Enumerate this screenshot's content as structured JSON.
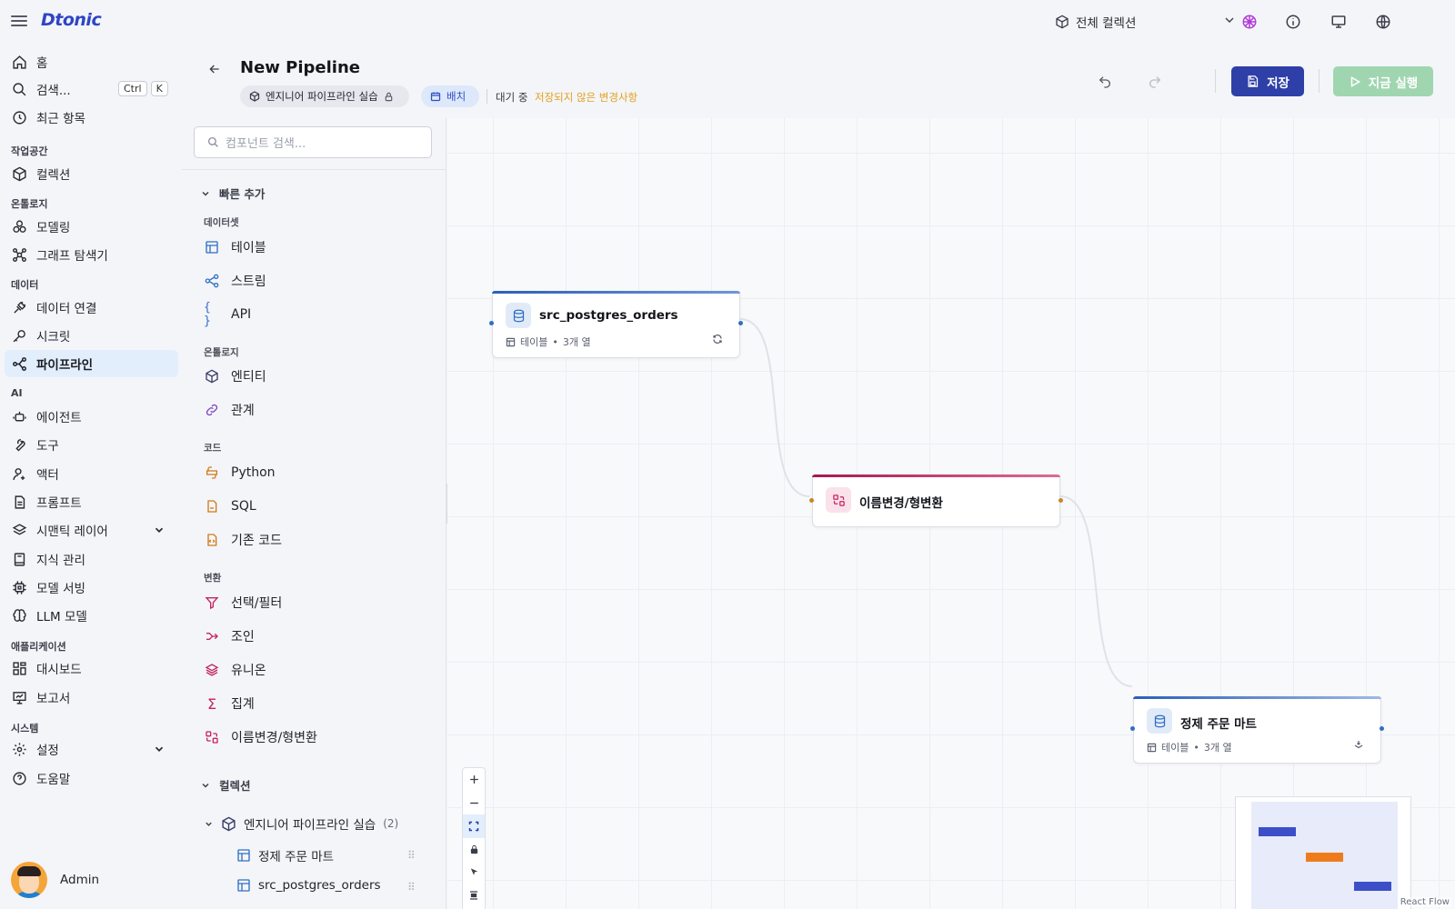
{
  "app": {
    "logo": "Dtonic"
  },
  "topbar": {
    "collection": "전체 컬렉션"
  },
  "sidebar": {
    "home": "홈",
    "search": "검색...",
    "kbd1": "Ctrl",
    "kbd2": "K",
    "recent": "최근 항목",
    "sec_workspace": "작업공간",
    "collection": "컬렉션",
    "sec_ontology": "온톨로지",
    "modeling": "모델링",
    "graph": "그래프 탐색기",
    "sec_data": "데이터",
    "data_conn": "데이터 연결",
    "secret": "시크릿",
    "pipeline": "파이프라인",
    "sec_ai": "AI",
    "agent": "에이전트",
    "tool": "도구",
    "actor": "액터",
    "prompt": "프롬프트",
    "semantic": "시맨틱 레이어",
    "knowledge": "지식 관리",
    "model_serving": "모델 서빙",
    "llm": "LLM 모델",
    "sec_app": "애플리케이션",
    "dashboard": "대시보드",
    "report": "보고서",
    "sec_system": "시스템",
    "settings": "설정",
    "help": "도움말",
    "user": "Admin"
  },
  "header": {
    "title": "New Pipeline",
    "project": "엔지니어 파이프라인 실습",
    "mode": "배치",
    "status": "대기 중",
    "unsaved": "저장되지 않은 변경사항",
    "save": "저장",
    "run": "지금 실행"
  },
  "panel": {
    "search_placeholder": "컴포넌트 검색...",
    "quick_add": "빠른 추가",
    "cat_dataset": "데이터셋",
    "table": "테이블",
    "stream": "스트림",
    "api": "API",
    "cat_ontology": "온톨로지",
    "entity": "엔티티",
    "relation": "관계",
    "cat_code": "코드",
    "python": "Python",
    "sql": "SQL",
    "legacy": "기존 코드",
    "cat_transform": "변환",
    "filter": "선택/필터",
    "join": "조인",
    "union": "유니온",
    "aggregate": "집계",
    "rename": "이름변경/형변환",
    "collections": "컬렉션",
    "tree_project": "엔지니어 파이프라인 실습",
    "tree_count": "(2)",
    "tree_item1": "정제 주문 마트",
    "tree_item2": "src_postgres_orders"
  },
  "nodes": {
    "source": {
      "title": "src_postgres_orders",
      "kind": "테이블",
      "cols": "3개 열"
    },
    "transform": {
      "title": "이름변경/형변환"
    },
    "sink": {
      "title": "정제 주문 마트",
      "kind": "테이블",
      "cols": "3개 열"
    }
  },
  "canvas": {
    "credit": "React Flow"
  },
  "colors": {
    "primary": "#2e3fa8",
    "run": "#9fd6b0",
    "warning": "#e0a020",
    "source": "#3b6fc9",
    "transform": "#c4245f"
  }
}
